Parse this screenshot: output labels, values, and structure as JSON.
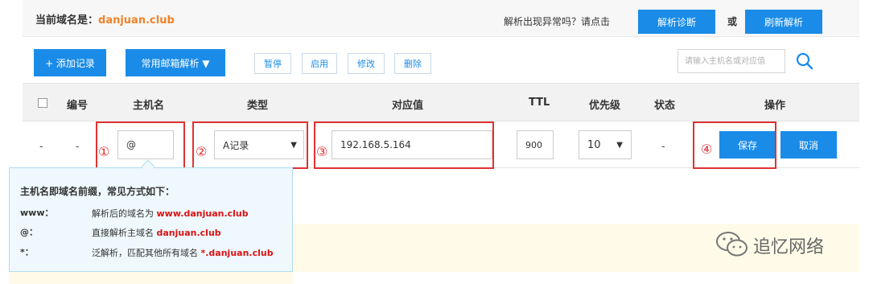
{
  "header": {
    "domain_label": "当前域名是：",
    "domain_value": "danjuan.club",
    "ask_text": "解析出现异常吗？请点击",
    "diagnose_label": "解析诊断",
    "or_text": "或",
    "refresh_label": "刷新解析"
  },
  "toolbar": {
    "add_label": "+ 添加记录",
    "mail_label": "常用邮箱解析 ▼",
    "pause_label": "暂停",
    "enable_label": "启用",
    "edit_label": "修改",
    "delete_label": "删除",
    "search_placeholder": "请输入主机名或对应值"
  },
  "table": {
    "columns": [
      "编号",
      "主机名",
      "类型",
      "对应值",
      "TTL",
      "优先级",
      "状态",
      "操作"
    ],
    "row": {
      "select": "-",
      "number": "-",
      "host": "@",
      "type": "A记录",
      "value": "192.168.5.164",
      "ttl": "900",
      "priority": "10",
      "status": "-",
      "save_label": "保存",
      "cancel_label": "取消"
    }
  },
  "annotations": [
    "①",
    "②",
    "③",
    "④"
  ],
  "tooltip": {
    "title": "主机名即域名前缀，常见方式如下：",
    "items": [
      {
        "key": "www：",
        "desc": "解析后的域名为 ",
        "highlight": "www.danjuan.club"
      },
      {
        "key": "@：",
        "desc": "直接解析主域名 ",
        "highlight": "danjuan.club"
      },
      {
        "key": "*：",
        "desc": "泛解析，匹配其他所有域名 ",
        "highlight": "*.danjuan.club"
      }
    ]
  },
  "watermark": {
    "text": "追忆网络",
    "icon": "wechat-icon"
  },
  "colors": {
    "accent": "#1a8ce8",
    "domain": "#f0832a",
    "annotation": "#e03131",
    "tooltip_bg": "#eef8fd",
    "highlight": "#dd1111"
  }
}
